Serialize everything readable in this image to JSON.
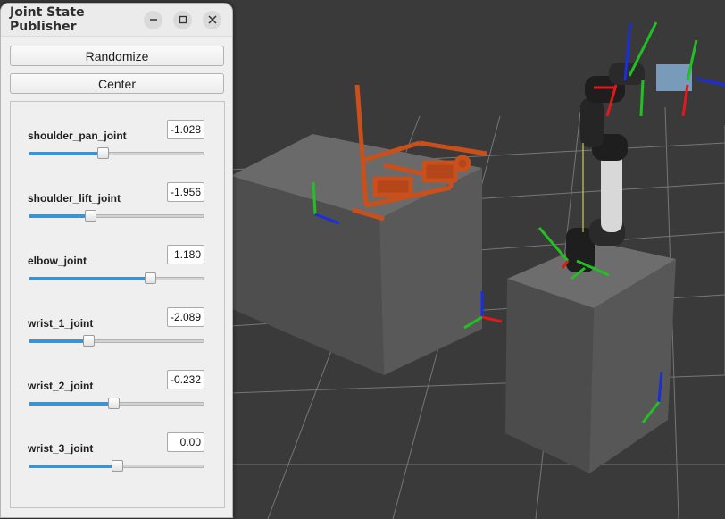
{
  "window": {
    "title": "Joint State Publisher",
    "randomize_label": "Randomize",
    "center_label": "Center"
  },
  "joints": [
    {
      "name": "shoulder_pan_joint",
      "value": "-1.028",
      "position": 0.42
    },
    {
      "name": "shoulder_lift_joint",
      "value": "-1.956",
      "position": 0.35
    },
    {
      "name": "elbow_joint",
      "value": "1.180",
      "position": 0.69
    },
    {
      "name": "wrist_1_joint",
      "value": "-2.089",
      "position": 0.34
    },
    {
      "name": "wrist_2_joint",
      "value": "-0.232",
      "position": 0.48
    },
    {
      "name": "wrist_3_joint",
      "value": "0.00",
      "position": 0.5
    }
  ],
  "colors": {
    "viewport_background": "#3a3a3a",
    "slider_fill": "#3c93d2",
    "robot_orange": "#c9501a",
    "box_gray": "#5a5a5a"
  }
}
